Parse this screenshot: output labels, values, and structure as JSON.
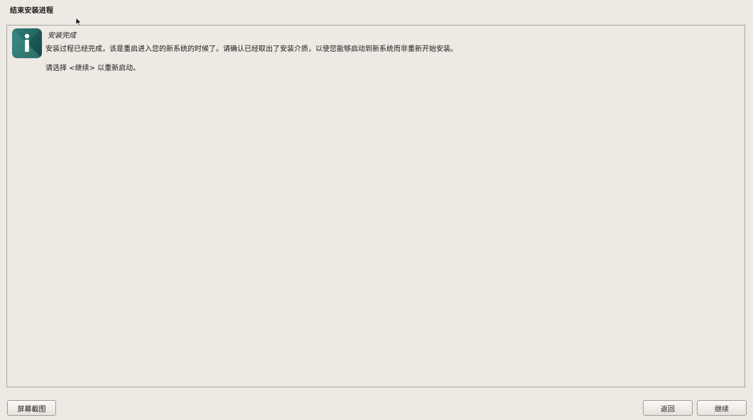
{
  "window": {
    "title": "结束安装进程"
  },
  "message": {
    "icon": "info-icon",
    "title": "安装完成",
    "body": "安装过程已经完成，该是重启进入您的新系统的时候了。请确认已经取出了安装介质，以使您能够启动到新系统而非重新开始安装。",
    "hint": "请选择 <继续> 以重新启动。"
  },
  "buttons": {
    "screenshot": "屏幕截图",
    "back": "返回",
    "continue": "继续"
  },
  "colors": {
    "background": "#ede9e3",
    "icon_dark": "#1f5f5c",
    "icon_light": "#3d8f88"
  }
}
